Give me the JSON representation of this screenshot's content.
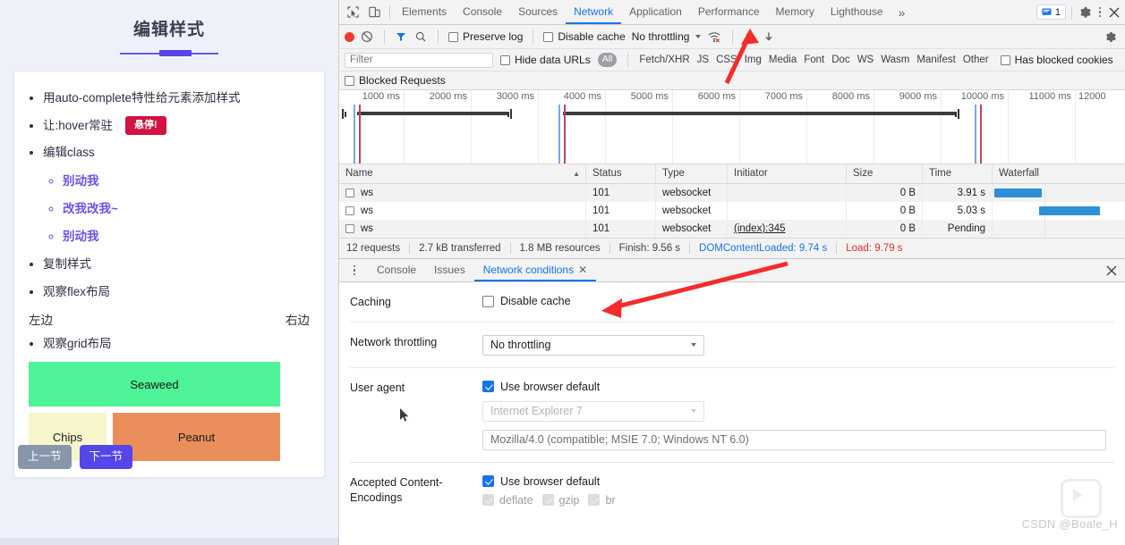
{
  "page": {
    "title": "编辑样式",
    "items": [
      {
        "text": "用auto-complete特性给元素添加样式"
      },
      {
        "text": "让:hover常驻",
        "badge": "悬停!"
      },
      {
        "text": "编辑class"
      },
      {
        "text": "复制样式"
      },
      {
        "text": "观察flex布局"
      },
      {
        "text": "观察grid布局"
      }
    ],
    "sub_items": [
      "别动我",
      "改我改我~",
      "别动我"
    ],
    "flex_left": "左边",
    "flex_right": "右边",
    "grid_cells": [
      {
        "label": "Seaweed",
        "color": "#4ef297"
      },
      {
        "label": "Chips",
        "color": "#f7f5cb"
      },
      {
        "label": "Peanut",
        "color": "#ea8e5b"
      }
    ],
    "prev_button": "上一节",
    "next_button": "下一节"
  },
  "devtools": {
    "tabs": [
      {
        "label": "Elements",
        "active": false
      },
      {
        "label": "Console",
        "active": false
      },
      {
        "label": "Sources",
        "active": false
      },
      {
        "label": "Network",
        "active": true
      },
      {
        "label": "Application",
        "active": false
      },
      {
        "label": "Performance",
        "active": false
      },
      {
        "label": "Memory",
        "active": false
      },
      {
        "label": "Lighthouse",
        "active": false
      }
    ],
    "more_tabs": "»",
    "message_count": "1",
    "network_toolbar": {
      "preserve_log": "Preserve log",
      "disable_cache": "Disable cache",
      "throttling": "No throttling"
    },
    "filter_bar": {
      "filter_placeholder": "Filter",
      "hide_data_urls": "Hide data URLs",
      "all_pill": "All",
      "types": [
        "Fetch/XHR",
        "JS",
        "CSS",
        "Img",
        "Media",
        "Font",
        "Doc",
        "WS",
        "Wasm",
        "Manifest",
        "Other"
      ],
      "has_blocked_cookies": "Has blocked cookies",
      "blocked_requests": "Blocked Requests"
    },
    "overview": {
      "ticks": [
        "1000 ms",
        "2000 ms",
        "3000 ms",
        "4000 ms",
        "5000 ms",
        "6000 ms",
        "7000 ms",
        "8000 ms",
        "9000 ms",
        "10000 ms",
        "11000 ms",
        "12000"
      ]
    },
    "table": {
      "columns": [
        "Name",
        "Status",
        "Type",
        "Initiator",
        "Size",
        "Time",
        "Waterfall"
      ],
      "rows": [
        {
          "name": "ws",
          "status": "101",
          "type": "websocket",
          "initiator": "",
          "size": "0 B",
          "time": "3.91 s"
        },
        {
          "name": "ws",
          "status": "101",
          "type": "websocket",
          "initiator": "",
          "size": "0 B",
          "time": "5.03 s"
        },
        {
          "name": "ws",
          "status": "101",
          "type": "websocket",
          "initiator": "(index):345",
          "size": "0 B",
          "time": "Pending"
        }
      ]
    },
    "summary": {
      "requests": "12 requests",
      "transferred": "2.7 kB transferred",
      "resources": "1.8 MB resources",
      "finish": "Finish: 9.56 s",
      "dom_content_loaded": "DOMContentLoaded: 9.74 s",
      "load": "Load: 9.79 s"
    },
    "drawer": {
      "tabs": [
        {
          "label": "Console",
          "active": false,
          "closable": false
        },
        {
          "label": "Issues",
          "active": false,
          "closable": false
        },
        {
          "label": "Network conditions",
          "active": true,
          "closable": true
        }
      ],
      "network_conditions": {
        "caching_label": "Caching",
        "disable_cache_label": "Disable cache",
        "throttling_label": "Network throttling",
        "throttling_value": "No throttling",
        "user_agent_label": "User agent",
        "use_browser_default": "Use browser default",
        "ua_select_value": "Internet Explorer 7",
        "ua_string": "Mozilla/4.0 (compatible; MSIE 7.0; Windows NT 6.0)",
        "encodings_label": "Accepted Content-Encodings",
        "encodings_default": "Use browser default",
        "encodings": [
          "deflate",
          "gzip",
          "br"
        ]
      }
    }
  },
  "watermark": "CSDN @Boale_H",
  "colors": {
    "accent": "#1a73e8",
    "record": "#ee3b2f",
    "load": "#d93025",
    "waterfall_bar": "#2f8fd6",
    "arrow": "#f42c2c"
  }
}
